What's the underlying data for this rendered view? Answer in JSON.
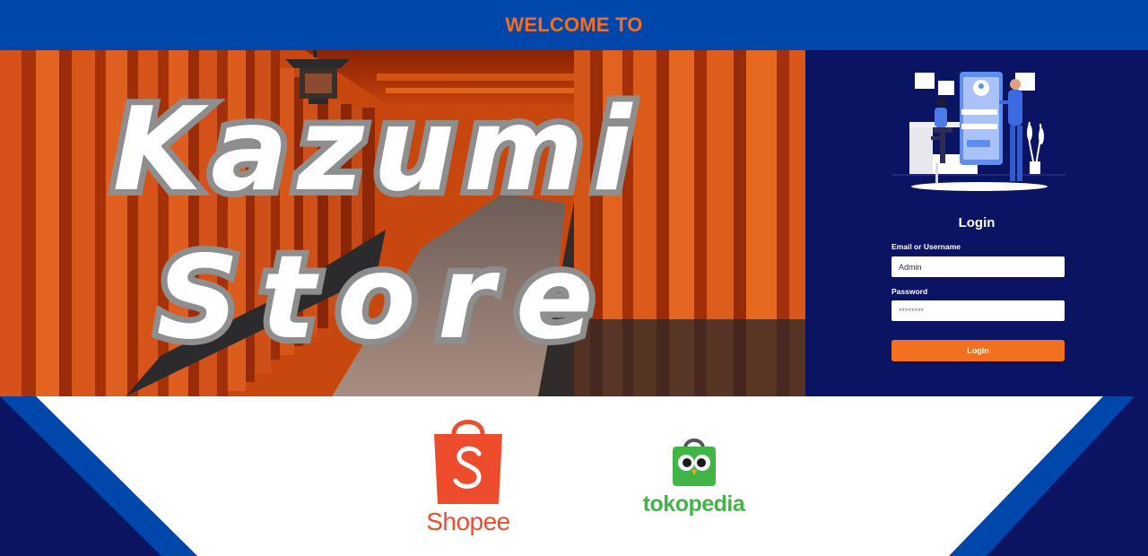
{
  "header": {
    "title": "WELCOME TO"
  },
  "hero": {
    "line1": "Kazumi",
    "line2": "Store"
  },
  "login": {
    "title": "Login",
    "username_label": "Email or Username",
    "username_value": "Admin",
    "password_label": "Password",
    "password_value": "********",
    "button_label": "Login"
  },
  "marketplaces": {
    "shopee": "Shopee",
    "tokopedia": "tokopedia"
  },
  "colors": {
    "header_bg": "#0047ab",
    "accent_orange": "#f26f21",
    "panel_navy": "#0b1462",
    "shopee_orange": "#ee4d2d",
    "tokopedia_green": "#42b549"
  },
  "icons": [
    "login-illustration",
    "shopee-bag-icon",
    "tokopedia-bag-icon"
  ]
}
